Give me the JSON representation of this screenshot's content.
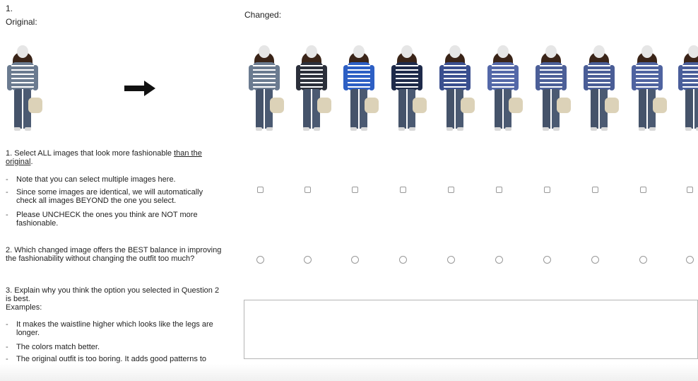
{
  "header": {
    "question_number": "1.",
    "original_label": "Original:",
    "changed_label": "Changed:"
  },
  "original_image": {
    "icon": "person-outfit-image",
    "top_color": "#6b7b90"
  },
  "arrow_icon": "arrow-right-icon",
  "changed_images": [
    {
      "icon": "person-outfit-image",
      "top_color": "#6b7b90"
    },
    {
      "icon": "person-outfit-image",
      "top_color": "#2b2f3a"
    },
    {
      "icon": "person-outfit-image",
      "top_color": "#2d5fc4"
    },
    {
      "icon": "person-outfit-image",
      "top_color": "#1e2a4a"
    },
    {
      "icon": "person-outfit-image",
      "top_color": "#3a4f8f"
    },
    {
      "icon": "person-outfit-image",
      "top_color": "#5468a8"
    },
    {
      "icon": "person-outfit-image",
      "top_color": "#4c5f98"
    },
    {
      "icon": "person-outfit-image",
      "top_color": "#4a5d96"
    },
    {
      "icon": "person-outfit-image",
      "top_color": "#4f63a0"
    },
    {
      "icon": "person-outfit-image",
      "top_color": "#4a5e9a"
    }
  ],
  "q1": {
    "prefix": "1. Select ALL images that look more fashionable ",
    "underlined": "than the original",
    "suffix": ".",
    "bullets": [
      "Note that you can select multiple images here.",
      "Since some images are identical, we will automatically check all images BEYOND the one you select.",
      "Please UNCHECK the ones you think are NOT more fashionable."
    ],
    "checkboxes": [
      false,
      false,
      false,
      false,
      false,
      false,
      false,
      false,
      false,
      false
    ]
  },
  "q2": {
    "text": "2. Which changed image offers the BEST balance in improving the fashionability without changing the outfit too much?",
    "radios": [
      false,
      false,
      false,
      false,
      false,
      false,
      false,
      false,
      false,
      false
    ]
  },
  "q3": {
    "text": "3. Explain why you think the option you selected in Question 2 is best.",
    "examples_label": "Examples:",
    "examples": [
      "It makes the waistline higher which looks like the legs are longer.",
      "The colors match better.",
      "The original outfit is too boring. It adds good patterns to the skirt."
    ],
    "answer_value": ""
  }
}
